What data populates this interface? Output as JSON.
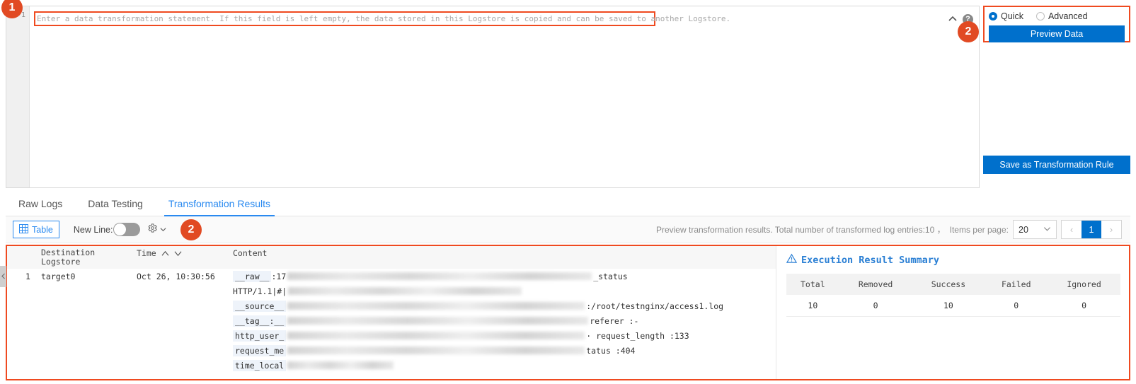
{
  "editor": {
    "line_number": "1",
    "placeholder": "Enter a data transformation statement. If this field is left empty, the data stored in this Logstore is copied and can be saved to another Logstore.",
    "collapse_icon": "chevron-up-icon",
    "help_icon": "help-icon",
    "help_label": "?"
  },
  "badges": {
    "one": "1",
    "two": "2",
    "three": "2"
  },
  "mode_panel": {
    "options": [
      {
        "label": "Quick",
        "selected": true
      },
      {
        "label": "Advanced",
        "selected": false
      }
    ],
    "quick_label": "Quick",
    "advanced_label": "Advanced",
    "preview_button": "Preview Data",
    "save_button": "Save as Transformation Rule",
    "accent_color": "#0070cc",
    "highlight_color": "#ef4a20"
  },
  "tabs": [
    {
      "label": "Raw Logs",
      "active": false
    },
    {
      "label": "Data Testing",
      "active": false
    },
    {
      "label": "Transformation Results",
      "active": true
    }
  ],
  "tab_labels": {
    "raw_logs": "Raw Logs",
    "data_testing": "Data Testing",
    "transformation_results": "Transformation Results"
  },
  "toolbar": {
    "table_button": "Table",
    "table_icon": "table-grid-icon",
    "new_line_label": "New Line:",
    "new_line_on": false,
    "gear_icon": "gear-icon",
    "chevron_down_icon": "chevron-down-icon",
    "status_text": "Preview transformation results. Total number of transformed log entries:10 ，",
    "items_per_page_label": "Items per page:",
    "items_per_page_value": "20",
    "prev_page": "‹",
    "current_page": "1",
    "next_page": "›"
  },
  "results_table": {
    "headers": {
      "index": "",
      "destination_logstore_line1": "Destination",
      "destination_logstore_line2": "Logstore",
      "time": "Time",
      "sort_asc_icon": "sort-ascending-icon",
      "sort_desc_icon": "sort-descending-icon",
      "content": "Content"
    },
    "rows": [
      {
        "index": "1",
        "destination_logstore": "target0",
        "time": "Oct 26, 10:30:56",
        "content_lines": [
          {
            "key": "__raw__",
            "sep": ":17",
            "redacted_width": 430,
            "tail": "_status"
          },
          {
            "key": "",
            "sep": "HTTP/1.1|#|",
            "redacted_width": 330,
            "tail": ""
          },
          {
            "key": "__source__",
            "sep": "",
            "redacted_width": 420,
            "tail": ":/root/testnginx/access1.log"
          },
          {
            "key": "__tag__:__",
            "sep": "",
            "redacted_width": 425,
            "tail": "referer :-"
          },
          {
            "key": "http_user_",
            "sep": "",
            "redacted_width": 420,
            "tail": "· request_length :133"
          },
          {
            "key": "request_me",
            "sep": "",
            "redacted_width": 420,
            "tail": "tatus :404"
          },
          {
            "key": "time_local",
            "sep": "",
            "redacted_width": 150,
            "tail": ""
          }
        ]
      }
    ]
  },
  "summary": {
    "warning_icon": "warning-triangle-icon",
    "title": "Execution Result Summary",
    "columns": [
      "Total",
      "Removed",
      "Success",
      "Failed",
      "Ignored"
    ],
    "values": [
      "10",
      "0",
      "10",
      "0",
      "0"
    ]
  },
  "collapse_handle": {
    "icon": "chevron-left-icon"
  }
}
